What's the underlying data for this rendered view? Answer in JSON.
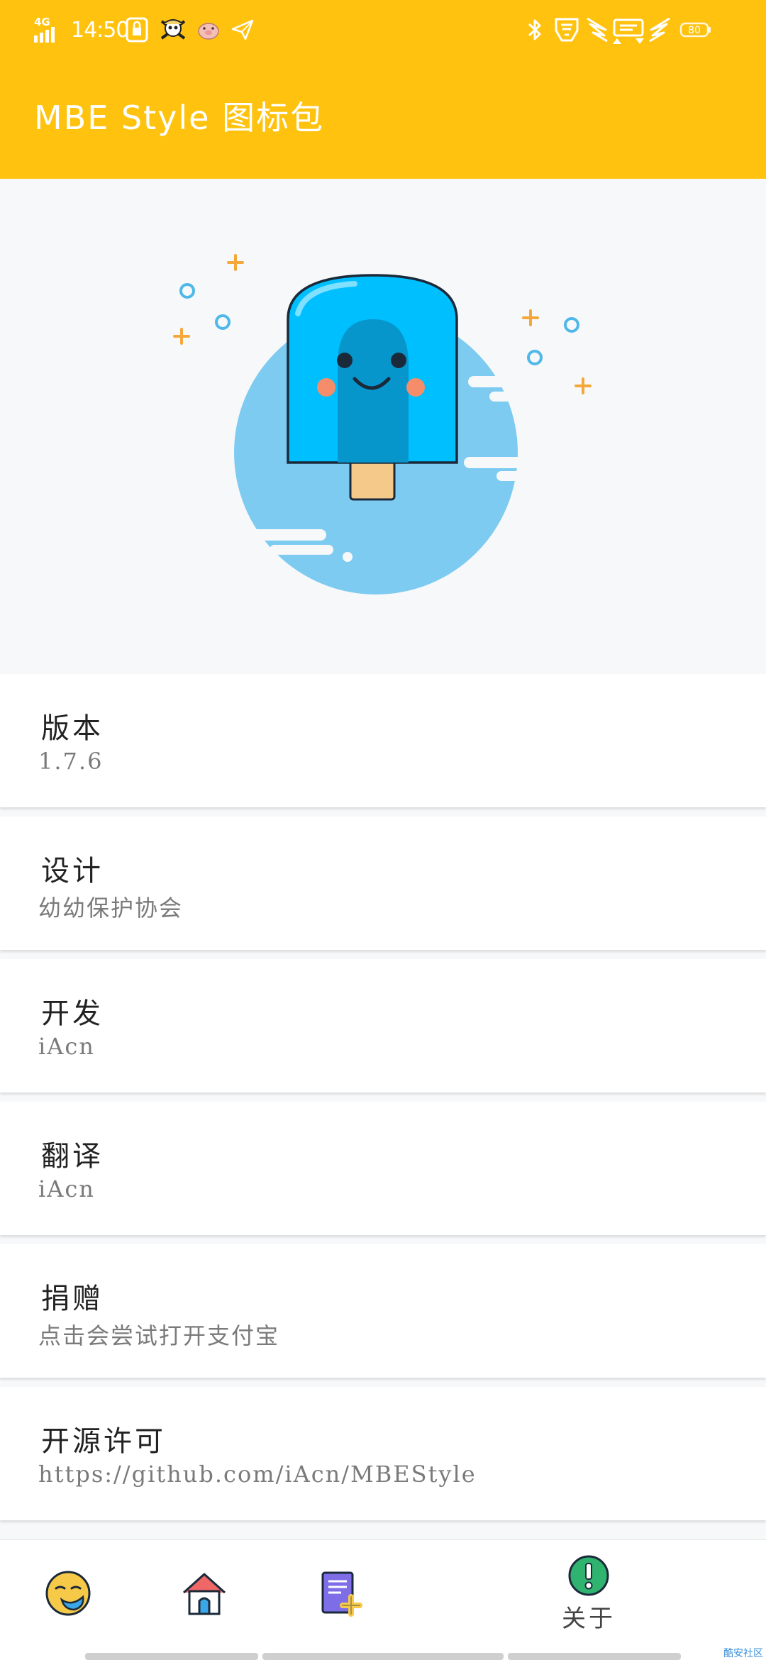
{
  "status_bar": {
    "network": "4G",
    "time": "14:50",
    "battery": "80",
    "icons_left": [
      "signal-icon",
      "lock-screen-icon",
      "pirate-skull-icon",
      "pig-app-icon",
      "paper-plane-icon"
    ],
    "icons_right": [
      "bluetooth-icon",
      "transformers-icon",
      "winged-logo-icon",
      "battery-icon"
    ]
  },
  "header": {
    "title": "MBE Style 图标包"
  },
  "hero": {
    "illustration": "popsicle-mascot-illustration",
    "colors": {
      "circle": "#7dcbf1",
      "popsicle": "#00bfff",
      "popsicle_dark": "#0796cc",
      "stick": "#f5c98a",
      "cheek": "#f58c6a",
      "sparkle": "#f5a83a"
    }
  },
  "info_items": [
    {
      "label": "版本",
      "value": "1.7.6"
    },
    {
      "label": "设计",
      "value": "幼幼保护协会"
    },
    {
      "label": "开发",
      "value": "iAcn"
    },
    {
      "label": "翻译",
      "value": "iAcn"
    },
    {
      "label": "捐赠",
      "value": "点击会尝试打开支付宝"
    },
    {
      "label": "开源许可",
      "value": "https://github.com/iAcn/MBEStyle"
    }
  ],
  "bottom_nav": {
    "items": [
      {
        "icon": "emoji-face-icon",
        "label": ""
      },
      {
        "icon": "home-icon",
        "label": ""
      },
      {
        "icon": "icon-request-icon",
        "label": ""
      },
      {
        "icon": "about-info-icon",
        "label": "关于",
        "selected": true
      }
    ]
  },
  "watermark": "酷安社区",
  "theme": {
    "accent": "#ffc20e",
    "background": "#f7f8f9",
    "card": "#ffffff"
  }
}
